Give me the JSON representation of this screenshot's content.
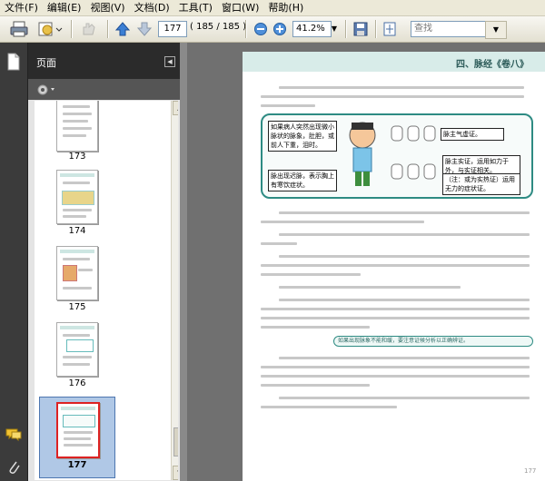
{
  "menu": [
    "文件(F)",
    "编辑(E)",
    "视图(V)",
    "文档(D)",
    "工具(T)",
    "窗口(W)",
    "帮助(H)"
  ],
  "toolbar": {
    "page_value": "177",
    "page_count": "( 185 / 185 )",
    "zoom_value": "41.2%",
    "search_placeholder": "查找",
    "icons": [
      "printer-icon",
      "email-icon",
      "hand-icon",
      "arrow-up-icon",
      "arrow-down-icon",
      "zoom-out-icon",
      "zoom-in-icon",
      "save-icon",
      "fit-page-icon"
    ]
  },
  "panel": {
    "title": "页面",
    "options_icon": "gear-icon",
    "thumbnails": [
      {
        "label": "173",
        "selected": false
      },
      {
        "label": "174",
        "selected": false
      },
      {
        "label": "175",
        "selected": false
      },
      {
        "label": "176",
        "selected": false
      },
      {
        "label": "177",
        "selected": true
      }
    ]
  },
  "document": {
    "chapter_title": "四、脉经《卷八》",
    "figure_labels": [
      "如果病人突然出现微小脉状的脉象，肚胆，或前人下重，泪时。",
      "脉主气虚证。",
      "脉主实证，运用如力于外，与实证相关。",
      "（注：或为实热证）运用无力的症状证。",
      "脉出现迟脉，表示胸上有寒饮症状。"
    ],
    "highlight_text": "如果出现脉象不能和缓，要注意证候分析以正确辨证。",
    "page_number": "177"
  },
  "colors": {
    "accent_teal": "#2e8b83",
    "chapter_band": "#d8ece9",
    "selection": "#b0c8e6"
  }
}
